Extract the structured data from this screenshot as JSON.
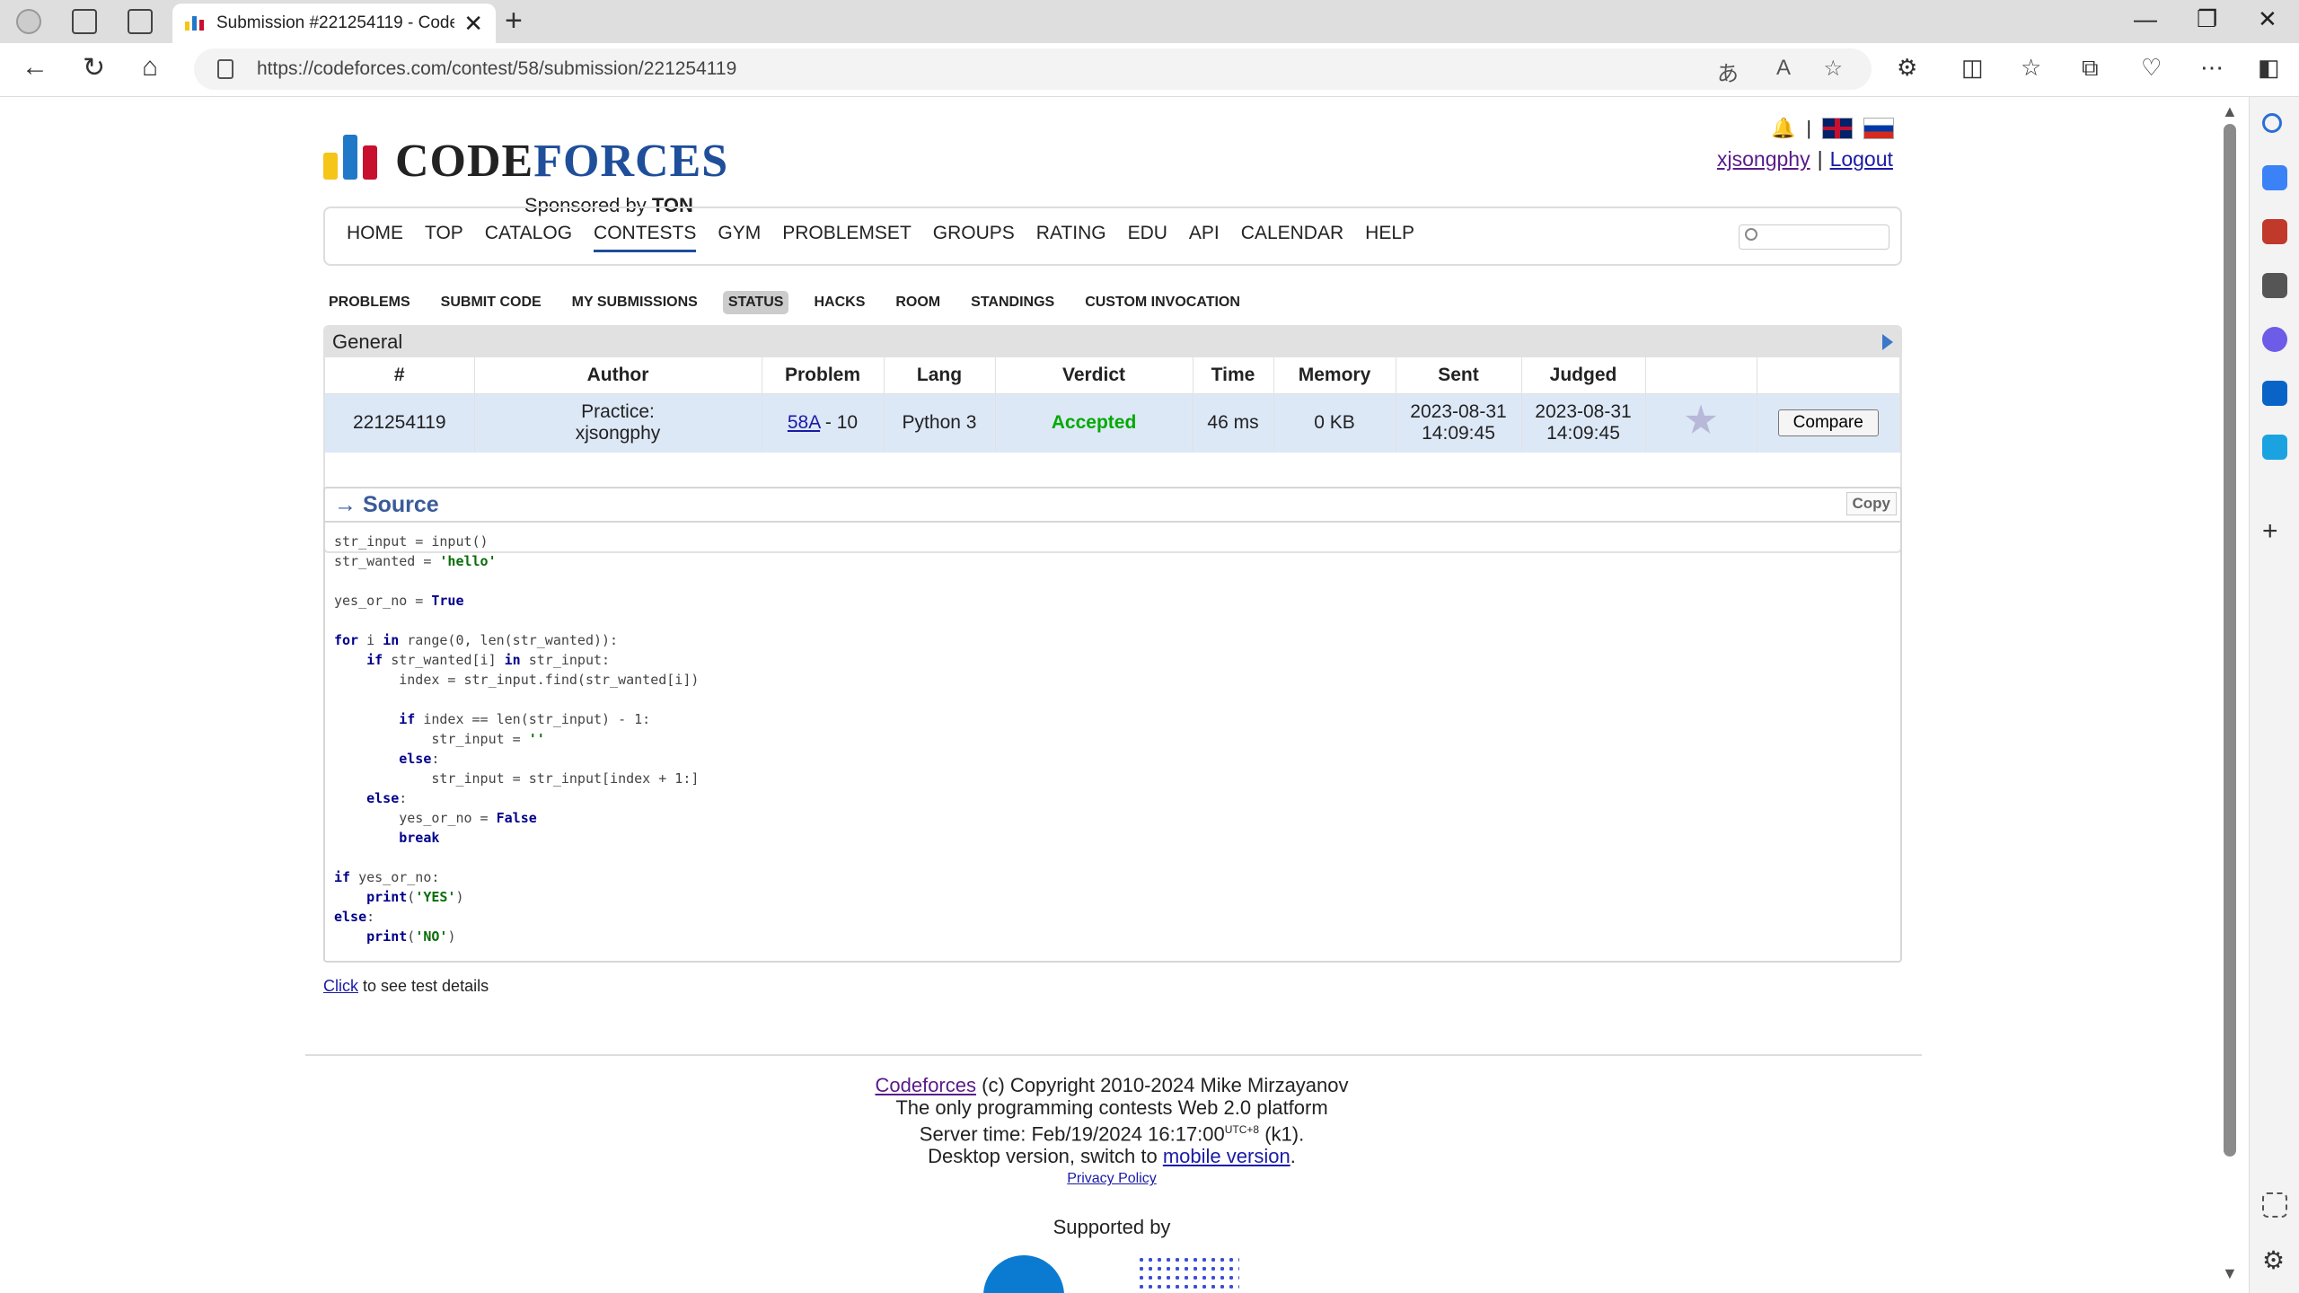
{
  "browser": {
    "tab_title": "Submission #221254119 - Codeforces",
    "url": "https://codeforces.com/contest/58/submission/221254119",
    "new_tab": "+",
    "close_tab": "✕"
  },
  "header": {
    "logo_code": "CODE",
    "logo_forces": "FORCES",
    "sponsored_prefix": "Sponsored by",
    "sponsor": "TON",
    "username": "xjsongphy",
    "logout": "Logout",
    "separator": "|"
  },
  "menu": [
    "HOME",
    "TOP",
    "CATALOG",
    "CONTESTS",
    "GYM",
    "PROBLEMSET",
    "GROUPS",
    "RATING",
    "EDU",
    "API",
    "CALENDAR",
    "HELP"
  ],
  "subnav": [
    "PROBLEMS",
    "SUBMIT CODE",
    "MY SUBMISSIONS",
    "STATUS",
    "HACKS",
    "ROOM",
    "STANDINGS",
    "CUSTOM INVOCATION"
  ],
  "general": {
    "title": "General",
    "columns": [
      "#",
      "Author",
      "Problem",
      "Lang",
      "Verdict",
      "Time",
      "Memory",
      "Sent",
      "Judged",
      "",
      ""
    ],
    "row": {
      "id": "221254119",
      "author_line1": "Practice:",
      "author_line2": "xjsongphy",
      "problem_link": "58A",
      "problem_rest": " - 10",
      "lang": "Python 3",
      "verdict": "Accepted",
      "time": "46 ms",
      "memory": "0 KB",
      "sent_date": "2023-08-31",
      "sent_time": "14:09:45",
      "judged_date": "2023-08-31",
      "judged_time": "14:09:45",
      "compare": "Compare"
    }
  },
  "source": {
    "title": "→ Source",
    "copy": "Copy"
  },
  "details": {
    "link": "Click",
    "text": " to see test details"
  },
  "footer": {
    "cf_link": "Codeforces",
    "copyright": " (c) Copyright 2010-2024 Mike Mirzayanov",
    "line2": "The only programming contests Web 2.0 platform",
    "server_time_prefix": "Server time: Feb/19/2024 16:17:00",
    "utc": "UTC+8",
    "server_suffix": " (k1).",
    "desktop_prefix": "Desktop version, switch to ",
    "mobile_link": "mobile version",
    "desktop_suffix": ".",
    "privacy": "Privacy Policy",
    "supported": "Supported by"
  }
}
